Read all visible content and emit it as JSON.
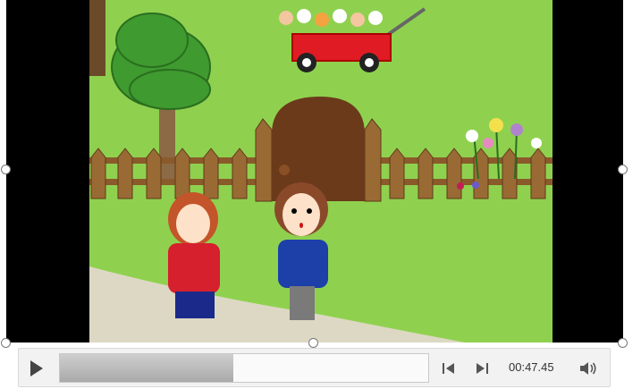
{
  "player": {
    "time": "00:47.45",
    "progress": 0.47
  },
  "icons": {
    "play": "play-icon",
    "back": "step-back-icon",
    "forward": "step-forward-icon",
    "volume": "volume-icon"
  },
  "colors": {
    "grass": "#8fd14f",
    "fence": "#8b5a2b",
    "door": "#6b3a1a",
    "wagon": "#e01b24"
  }
}
